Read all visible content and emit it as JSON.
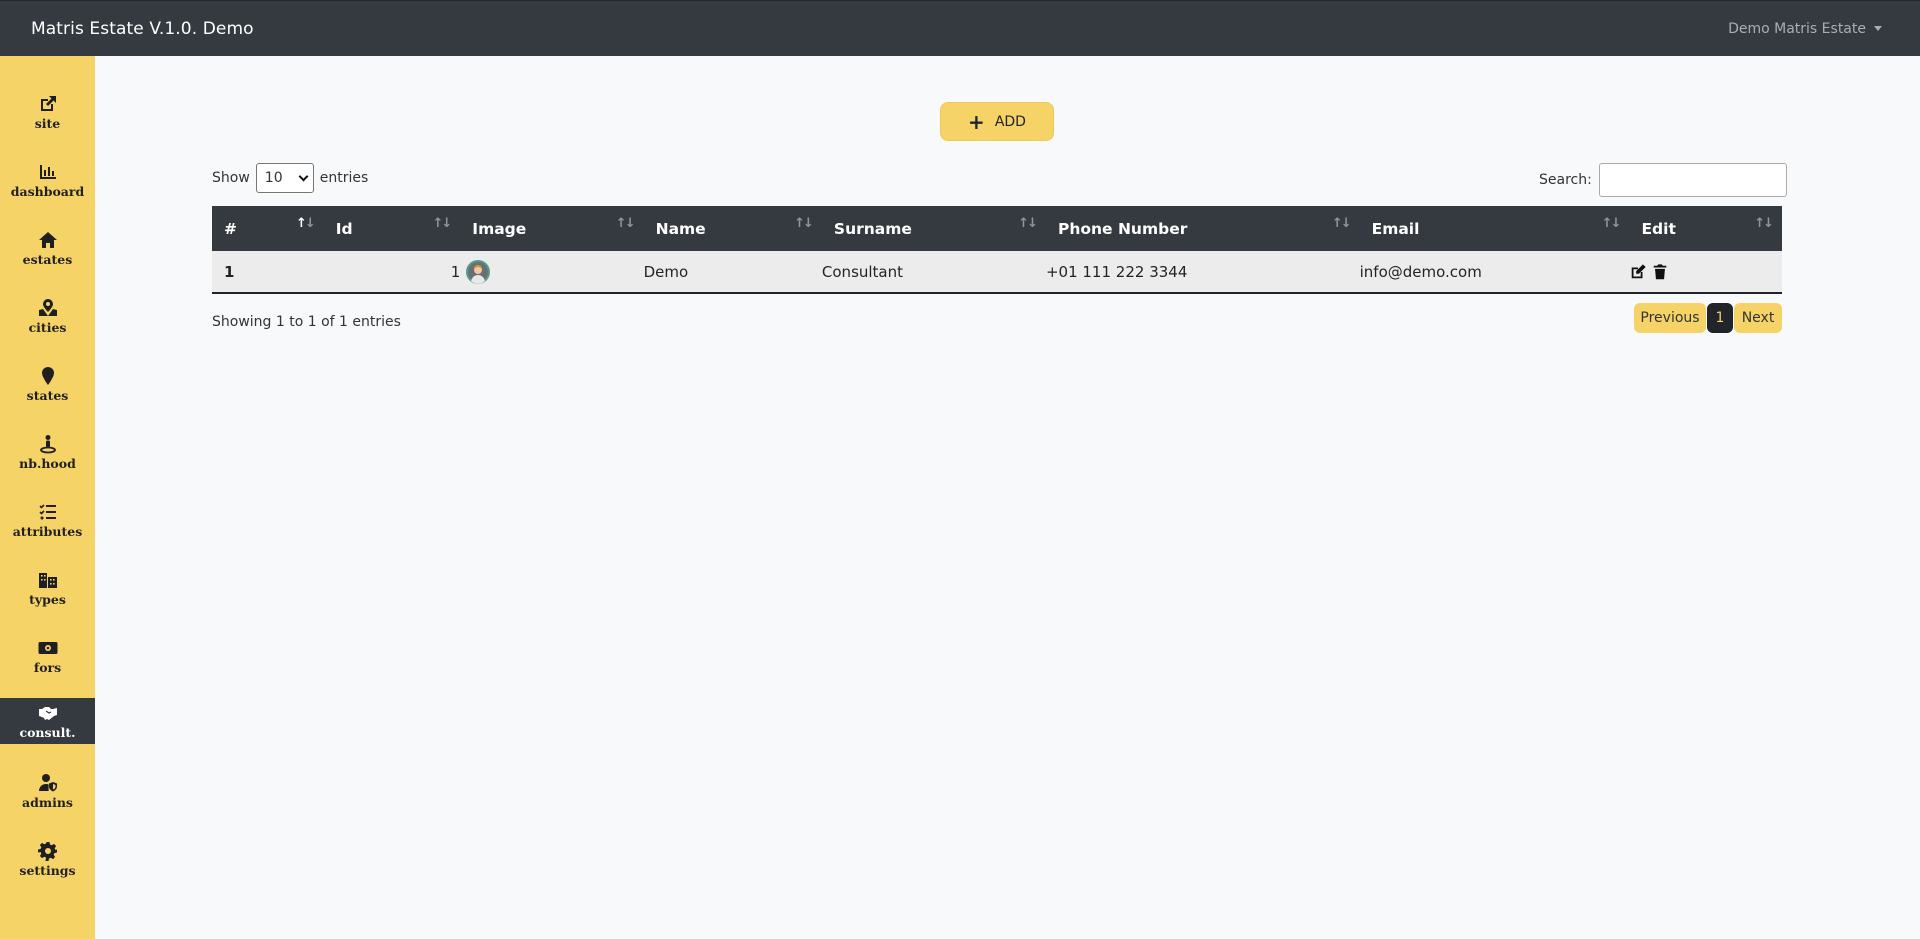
{
  "app": {
    "title": "Matris Estate V.1.0. Demo",
    "user_menu": "Demo Matris Estate"
  },
  "sidebar": {
    "active": "consult.",
    "items": [
      {
        "label": "site",
        "icon": "external-link-icon"
      },
      {
        "label": "dashboard",
        "icon": "chart-icon"
      },
      {
        "label": "estates",
        "icon": "home-icon"
      },
      {
        "label": "cities",
        "icon": "map-pin-icon"
      },
      {
        "label": "states",
        "icon": "marker-icon"
      },
      {
        "label": "nb.hood",
        "icon": "person-pin-icon"
      },
      {
        "label": "attributes",
        "icon": "checklist-icon"
      },
      {
        "label": "types",
        "icon": "buildings-icon"
      },
      {
        "label": "fors",
        "icon": "money-icon"
      },
      {
        "label": "consult.",
        "icon": "handshake-icon"
      },
      {
        "label": "admins",
        "icon": "user-shield-icon"
      },
      {
        "label": "settings",
        "icon": "gear-icon"
      }
    ]
  },
  "toolbar": {
    "add_label": "ADD"
  },
  "table_controls": {
    "show": "Show",
    "page_length": "10",
    "entries": "entries",
    "search_label": "Search:",
    "search_value": ""
  },
  "table": {
    "columns": [
      "#",
      "Id",
      "Image",
      "Name",
      "Surname",
      "Phone Number",
      "Email",
      "Edit"
    ],
    "rows": [
      {
        "num": "1",
        "id": "1",
        "image": "avatar-icon",
        "name": "Demo",
        "surname": "Consultant",
        "phone": "+01 111 222 3344",
        "email": "info@demo.com"
      }
    ]
  },
  "footer": {
    "info": "Showing 1 to 1 of 1 entries",
    "previous": "Previous",
    "page": "1",
    "next": "Next"
  }
}
